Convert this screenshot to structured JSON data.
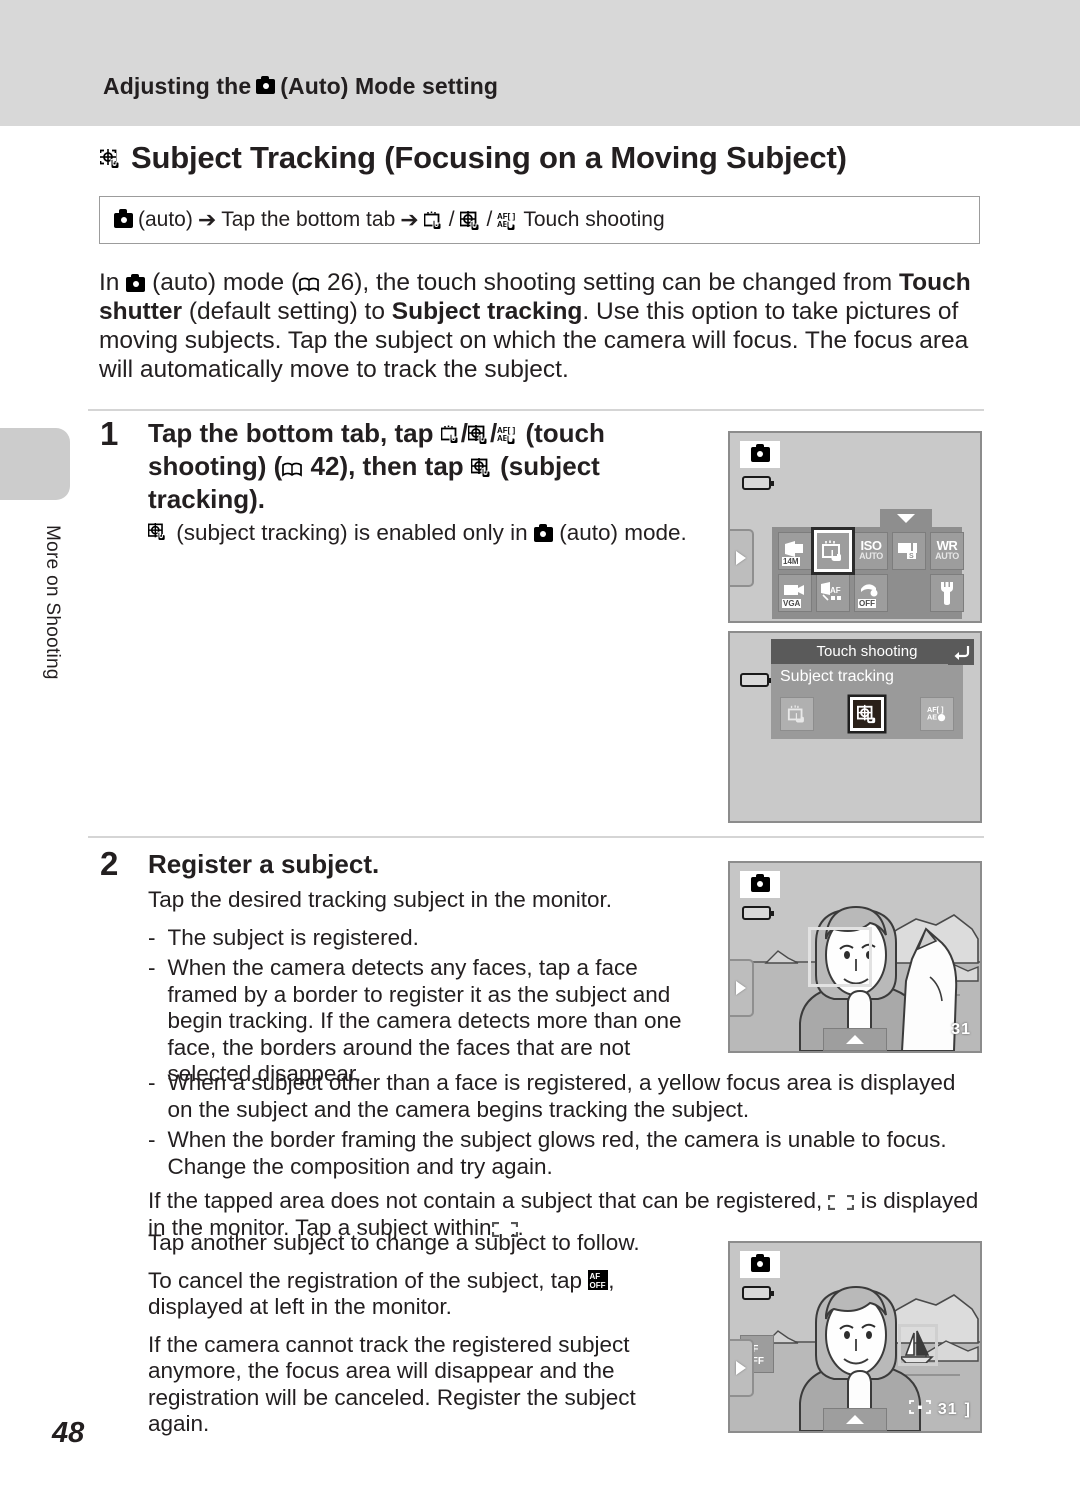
{
  "running_head": {
    "prefix": "Adjusting the",
    "icon": "camera-auto-icon",
    "suffix": "(Auto) Mode setting"
  },
  "section": {
    "icon": "subject-tracking-icon",
    "title": "Subject Tracking (Focusing on a Moving Subject)"
  },
  "path_box": {
    "mode_label": "(auto)",
    "arrow": "➔",
    "step1": "Tap the bottom tab",
    "icons": [
      "touch-shutter-icon",
      "subject-tracking-icon",
      "af-ae-lock-icon"
    ],
    "separator": "/",
    "end": "Touch shooting"
  },
  "intro": {
    "line1_a": "In",
    "line1_b": "(auto) mode (",
    "page_ref": "26",
    "line1_c": "), the touch shooting setting can be changed from",
    "bold1": "Touch shutter",
    "mid1": "(default setting) to",
    "bold2": "Subject tracking",
    "rest": ". Use this option to take pictures of moving subjects. Tap the subject on which the camera will focus. The focus area will automatically move to track the subject."
  },
  "steps": [
    {
      "number": "1",
      "head_a": "Tap the bottom tab, tap",
      "head_b": "(touch shooting) (",
      "head_ref": "42",
      "head_c": "), then tap",
      "head_d": "(subject tracking).",
      "note_a": "(subject tracking) is enabled only in",
      "note_b": "(auto) mode."
    },
    {
      "number": "2",
      "head": "Register a subject.",
      "lead": "Tap the desired tracking subject in the monitor.",
      "bullets": [
        "The subject is registered.",
        "When the camera detects any faces, tap a face framed by a border to register it as the subject and begin tracking. If the camera detects more than one face, the borders around the faces that are not selected disappear.",
        "When a subject other than a face is registered, a yellow focus area is displayed on the subject and the camera begins tracking the subject.",
        "When the border framing the subject glows red, the camera is unable to focus. Change the composition and try again."
      ],
      "dash": "-",
      "para_bracket_a": "If the tapped area does not contain a subject that can be registered,",
      "para_bracket_b": "is displayed in the monitor. Tap a subject within",
      "para_bracket_c": ".",
      "para_change": "Tap another subject to change a subject to follow.",
      "para_cancel_a": "To cancel the registration of the subject, tap",
      "para_cancel_b": ", displayed at left in the monitor.",
      "para_lost": "If the camera cannot track the registered subject anymore, the focus area will disappear and the registration will be canceled. Register the subject again."
    }
  ],
  "screens": {
    "menu_screen": {
      "name": "shooting-menu-screen",
      "items": [
        {
          "label": "14M",
          "kind": "image-size-icon"
        },
        {
          "label": "",
          "kind": "touch-shooting-icon",
          "selected": true
        },
        {
          "label": "ISO",
          "sub": "AUTO",
          "kind": "iso-icon"
        },
        {
          "label": "",
          "sub": "S",
          "kind": "continuous-icon"
        },
        {
          "label": "WR",
          "sub": "AUTO",
          "kind": "white-balance-icon"
        },
        {
          "label": "VGA",
          "kind": "movie-options-icon"
        },
        {
          "label": "AF",
          "kind": "af-mode-icon"
        },
        {
          "label": "OFF",
          "kind": "blink-warning-icon"
        },
        {
          "label": "",
          "kind": "setup-wrench-icon"
        }
      ]
    },
    "dialog_screen": {
      "name": "touch-shooting-dialog",
      "title": "Touch shooting",
      "subtitle": "Subject tracking",
      "options": [
        "touch-shutter-icon",
        "subject-tracking-icon",
        "af-ae-lock-icon"
      ],
      "selected_index": 1,
      "back_icon": "back-arrow-icon"
    },
    "photo_register": {
      "name": "register-subject-preview",
      "frame_number": "31"
    },
    "photo_tracking": {
      "name": "tracking-subject-preview",
      "frame_number": "31",
      "cancel_icon": "af-off-icon"
    }
  },
  "edge_tab": {
    "label": "More on Shooting"
  },
  "folio": "48",
  "colors": {
    "band": "#d8d8d8",
    "tab": "#cccccc",
    "rule": "#d5d5d5",
    "text": "#231f20",
    "screen_bg": "#c9c9c9"
  }
}
